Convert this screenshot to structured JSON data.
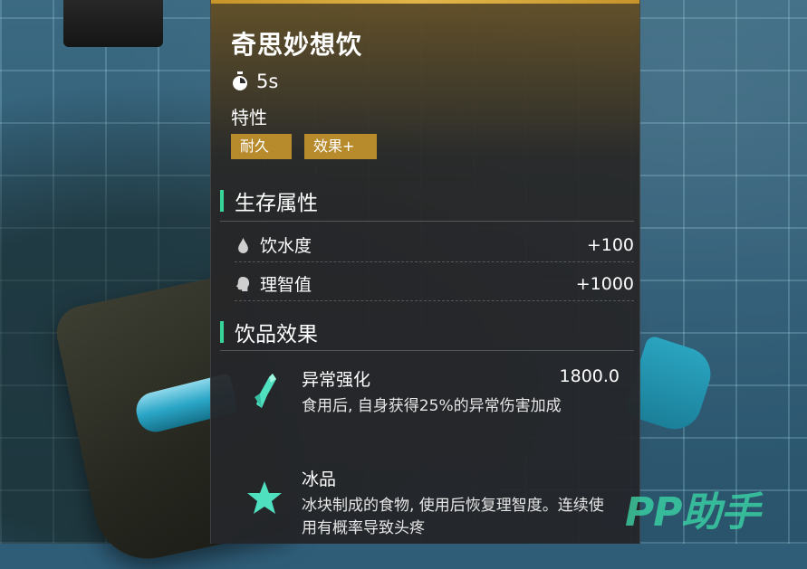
{
  "item": {
    "name": "奇思妙想饮",
    "time": "5s",
    "traits_label": "特性",
    "tags": [
      "耐久",
      "效果+"
    ]
  },
  "survival": {
    "heading": "生存属性",
    "stats": [
      {
        "icon": "water-drop-icon",
        "label": "饮水度",
        "value": "+100"
      },
      {
        "icon": "head-icon",
        "label": "理智值",
        "value": "+1000"
      }
    ]
  },
  "drink_effects": {
    "heading": "饮品效果",
    "effects": [
      {
        "icon": "crystal-shard-icon",
        "name": "异常强化",
        "value": "1800.0",
        "desc": "食用后, 自身获得25%的异常伤害加成"
      },
      {
        "icon": "star-icon",
        "name": "冰品",
        "value": "",
        "desc": "冰块制成的食物, 使用后恢复理智度。连续使用有概率导致头疼"
      }
    ]
  },
  "watermark": "PP助手",
  "colors": {
    "accent_gold": "#b78a2c",
    "accent_green": "#38d59a",
    "icon_teal": "#4fe0c0"
  }
}
